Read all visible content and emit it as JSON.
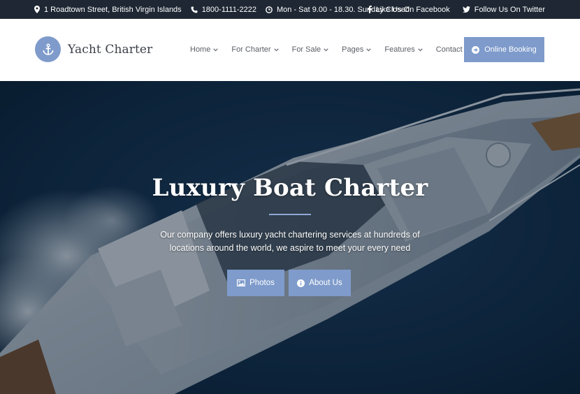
{
  "topbar": {
    "address": "1 Roadtown Street, British Virgin Islands",
    "phone": "1800-1111-2222",
    "hours": "Mon - Sat 9.00 - 18.30. Sunday Closed",
    "facebook": "Like Us On Facebook",
    "twitter": "Follow Us On Twitter"
  },
  "header": {
    "logo_text": "Yacht Charter",
    "nav": [
      {
        "label": "Home"
      },
      {
        "label": "For Charter"
      },
      {
        "label": "For Sale"
      },
      {
        "label": "Pages"
      },
      {
        "label": "Features"
      },
      {
        "label": "Contact"
      }
    ],
    "booking_label": "Online Booking"
  },
  "hero": {
    "title": "Luxury Boat Charter",
    "subtitle": "Our company offers luxury yacht chartering services at hundreds of locations around the world, we aspire to meet your every need",
    "photos_label": "Photos",
    "about_label": "About Us"
  },
  "colors": {
    "accent": "#7e9bcb",
    "topbar_bg": "#1e2733",
    "sea": "#0b2540"
  }
}
